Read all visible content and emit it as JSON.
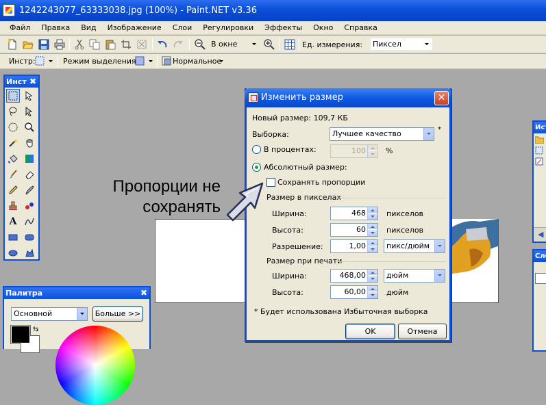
{
  "window": {
    "title": "1242243077_63333038.jpg (100%) - Paint.NET v3.36"
  },
  "menubar": {
    "items": [
      "Файл",
      "Правка",
      "Вид",
      "Изображение",
      "Слои",
      "Регулировки",
      "Эффекты",
      "Окно",
      "Справка"
    ]
  },
  "toolbar": {
    "zoom_value": "В окне",
    "units_label": "Ед. измерения:",
    "units_value": "Пиксел"
  },
  "toolbar2": {
    "tool_label": "Инстр:",
    "selection_mode_label": "Режим выделения:",
    "blend_mode_value": "Нормальное"
  },
  "tools_panel": {
    "title": "Инст",
    "close": "✖"
  },
  "palette_panel": {
    "title": "Палитра",
    "close": "✖",
    "mode_value": "Основной",
    "more_button": "Больше >>"
  },
  "right_panels": {
    "history_title": "Ист",
    "layers_title": "Сло"
  },
  "dialog": {
    "title": "Изменить размер",
    "close": "✕",
    "new_size": "Новый размер: 109,7 КБ",
    "resampling_label": "Выборка:",
    "resampling_value": "Лучшее качество",
    "percent_label": "В процентах:",
    "percent_value": "100",
    "percent_unit": "%",
    "absolute_label": "Абсолютный размер:",
    "keep_ratio_label": "Сохранять пропорции",
    "pixel_size_header": "Размер в пикселах",
    "width_label": "Ширина:",
    "width_px": "468",
    "width_px_unit": "пикселов",
    "height_label": "Высота:",
    "height_px": "60",
    "height_px_unit": "пикселов",
    "resolution_label": "Разрешение:",
    "resolution_value": "1,00",
    "resolution_unit": "пикс/дюйм",
    "print_size_header": "Размер при печати",
    "print_width_label": "Ширина:",
    "print_width_value": "468,00",
    "print_width_unit": "дюйм",
    "print_height_label": "Высота:",
    "print_height_value": "60,00",
    "print_height_unit": "дюйм",
    "footnote": "* Будет использована Избыточная выборка",
    "ok_button": "OK",
    "cancel_button": "Отмена"
  },
  "annotation": {
    "line1": "Пропорции не",
    "line2": "сохранять"
  },
  "colors": {
    "xp_blue": "#0a4fd9",
    "face": "#ece9d8",
    "workspace": "#a8a8a8"
  }
}
